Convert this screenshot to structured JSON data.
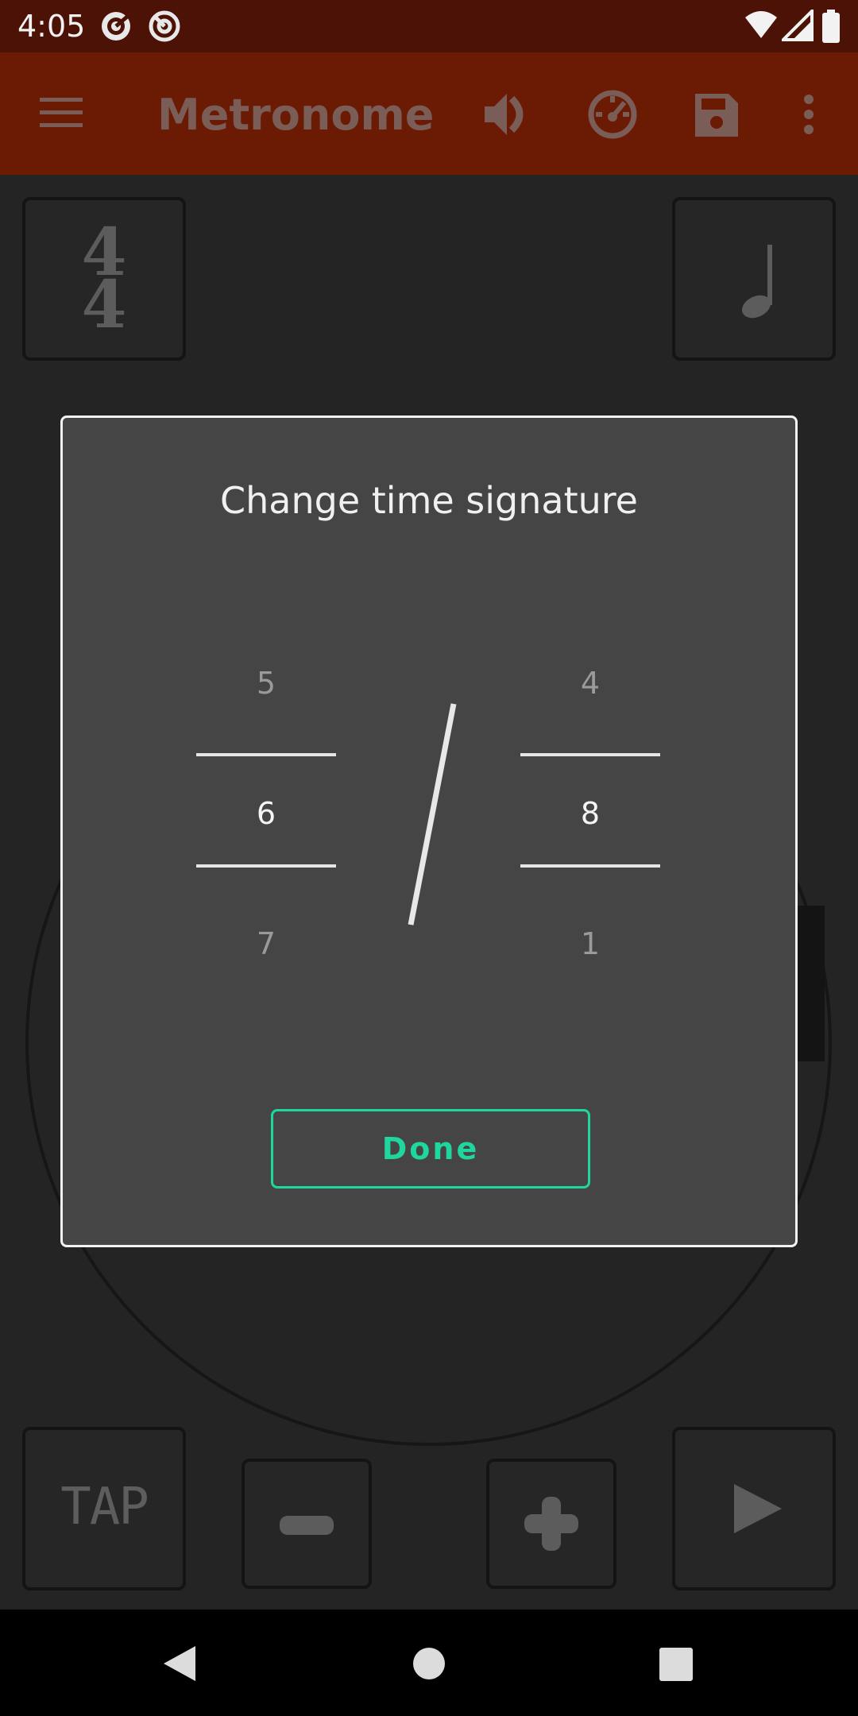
{
  "status_bar": {
    "time": "4:05"
  },
  "app_bar": {
    "title": "Metronome"
  },
  "main": {
    "time_signature_top": "4",
    "time_signature_bottom": "4",
    "tap_label": "TAP"
  },
  "dialog": {
    "title": "Change time signature",
    "numerator": {
      "above": "5",
      "selected": "6",
      "below": "7"
    },
    "denominator": {
      "above": "4",
      "selected": "8",
      "below": "1"
    },
    "done_label": "Done"
  },
  "colors": {
    "status_bar": "#4c1206",
    "app_bar": "#6b1b04",
    "dialog_bg": "#454545",
    "accent": "#1fd69f"
  }
}
